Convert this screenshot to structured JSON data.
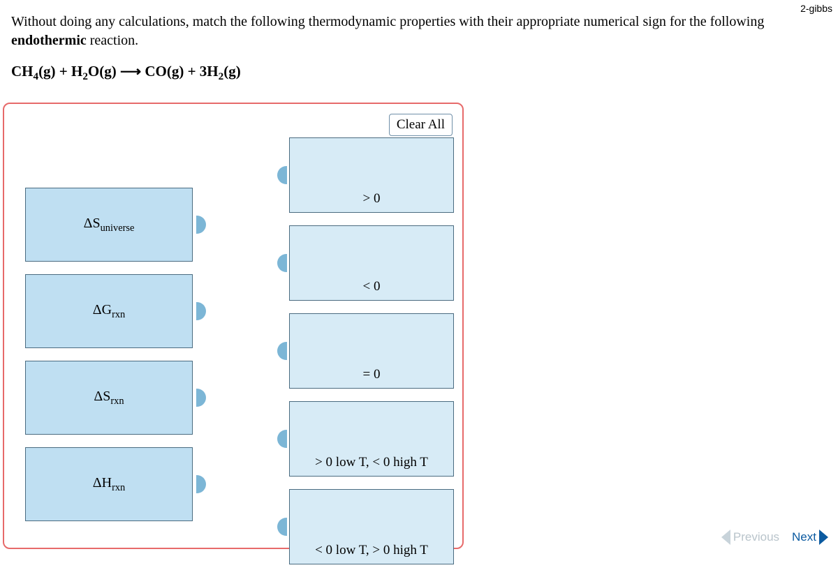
{
  "meta": {
    "tag": "2-gibbs"
  },
  "prompt": {
    "text_before_bold": "Without doing any calculations, match the following thermodynamic properties with their appropriate numerical sign for the following ",
    "bold_word": "endothermic",
    "text_after_bold": " reaction."
  },
  "equation": {
    "html": "CH<sub>4</sub>(g) + H<sub>2</sub>O(g) ⟶ CO(g) + 3H<sub>2</sub>(g)"
  },
  "buttons": {
    "clear_all": "Clear All",
    "previous": "Previous",
    "next": "Next"
  },
  "sources": [
    {
      "label_html": "ΔS<sub>universe</sub>"
    },
    {
      "label_html": "ΔG<sub>rxn</sub>"
    },
    {
      "label_html": "ΔS<sub>rxn</sub>"
    },
    {
      "label_html": "ΔH<sub>rxn</sub>"
    }
  ],
  "targets": [
    {
      "label": "> 0"
    },
    {
      "label": "< 0"
    },
    {
      "label": "= 0"
    },
    {
      "label": "> 0 low T, < 0 high T"
    },
    {
      "label": "< 0 low T, > 0 high T"
    }
  ]
}
